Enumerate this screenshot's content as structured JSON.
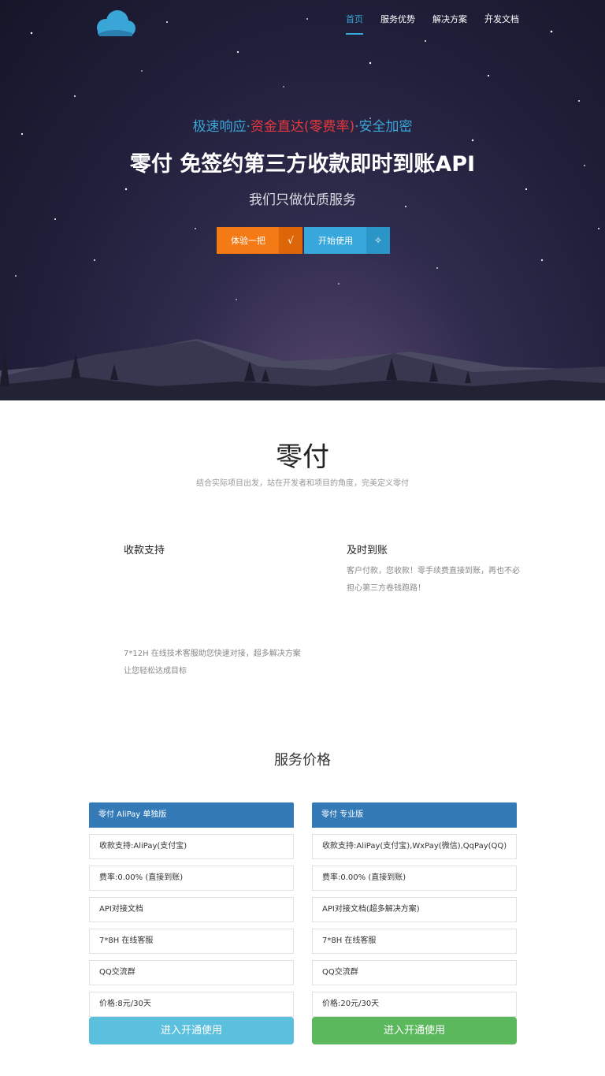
{
  "nav": {
    "items": [
      {
        "label": "首页",
        "active": true
      },
      {
        "label": "服务优势",
        "active": false
      },
      {
        "label": "解决方案",
        "active": false
      },
      {
        "label": "开发文档",
        "active": false
      }
    ]
  },
  "hero": {
    "tagline": {
      "part1": "极速响应",
      "sep1": "·",
      "part2": "资金直达(零费率)",
      "sep2": "·",
      "part3": "安全加密"
    },
    "title": "零付 免签约第三方收款即时到账API",
    "subtitle": "我们只做优质服务",
    "btn_try": {
      "label": "体验一把",
      "icon": "√"
    },
    "btn_start": {
      "label": "开始使用",
      "icon": "✧"
    }
  },
  "intro": {
    "title": "零付",
    "subtitle": "结合实际项目出发，站在开发者和项目的角度，完美定义零付",
    "features": [
      {
        "title": "收款支持",
        "text": ""
      },
      {
        "title": "及时到账",
        "text": "客户付款，您收款！零手续费直接到账，再也不必担心第三方卷钱跑路！"
      },
      {
        "title": "",
        "text": "7*12H 在线技术客服助您快速对接，超多解决方案让您轻松达成目标"
      }
    ]
  },
  "pricing": {
    "title": "服务价格",
    "plans": [
      {
        "name": "零付 AliPay 单独版",
        "rows": [
          "收款支持:AliPay(支付宝)",
          "费率:0.00% (直接到账)",
          "API对接文档",
          "7*8H 在线客服",
          "QQ交流群",
          "价格:8元/30天"
        ],
        "button": "进入开通使用"
      },
      {
        "name": "零付 专业版",
        "rows": [
          "收款支持:AliPay(支付宝),WxPay(微信),QqPay(QQ)",
          "费率:0.00% (直接到账)",
          "API对接文档(超多解决方案)",
          "7*8H 在线客服",
          "QQ交流群",
          "价格:20元/30天"
        ],
        "button": "进入开通使用"
      }
    ]
  },
  "icons": {
    "logo": "cloud-logo",
    "try": "check-icon",
    "start": "sparkle-icon"
  },
  "colors": {
    "accent": "#3aa6d8",
    "red": "#e8383d",
    "orange": "#f47a15",
    "blue_header": "#337ab7",
    "info": "#5bc0de",
    "success": "#5cb85c"
  }
}
